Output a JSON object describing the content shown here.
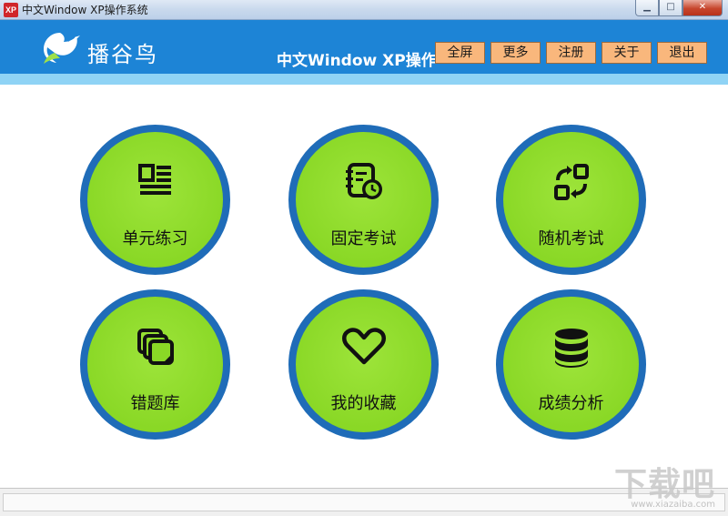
{
  "window": {
    "icon_text": "XP",
    "title": "中文Window XP操作系统",
    "controls": {
      "minimize": "▁",
      "maximize": "□",
      "close": "✕"
    }
  },
  "header": {
    "logo_text": "播谷鸟",
    "app_title": "中文Window XP操作系统",
    "buttons": [
      "全屏",
      "更多",
      "注册",
      "关于",
      "退出"
    ],
    "colors": {
      "header_bg": "#1d84d6",
      "strip": "#8fd3f5",
      "button_bg": "#f9b77c"
    }
  },
  "tiles": [
    {
      "label": "单元练习",
      "icon": "article-icon"
    },
    {
      "label": "固定考试",
      "icon": "notebook-clock-icon"
    },
    {
      "label": "随机考试",
      "icon": "shuffle-icon"
    },
    {
      "label": "错题库",
      "icon": "stacked-cards-icon"
    },
    {
      "label": "我的收藏",
      "icon": "heart-icon"
    },
    {
      "label": "成绩分析",
      "icon": "database-icon"
    }
  ],
  "tile_colors": {
    "fill": "#8ad826",
    "ring": "#1f6cb8"
  },
  "watermark": {
    "main": "下载吧",
    "sub": "www.xiazaiba.com"
  }
}
